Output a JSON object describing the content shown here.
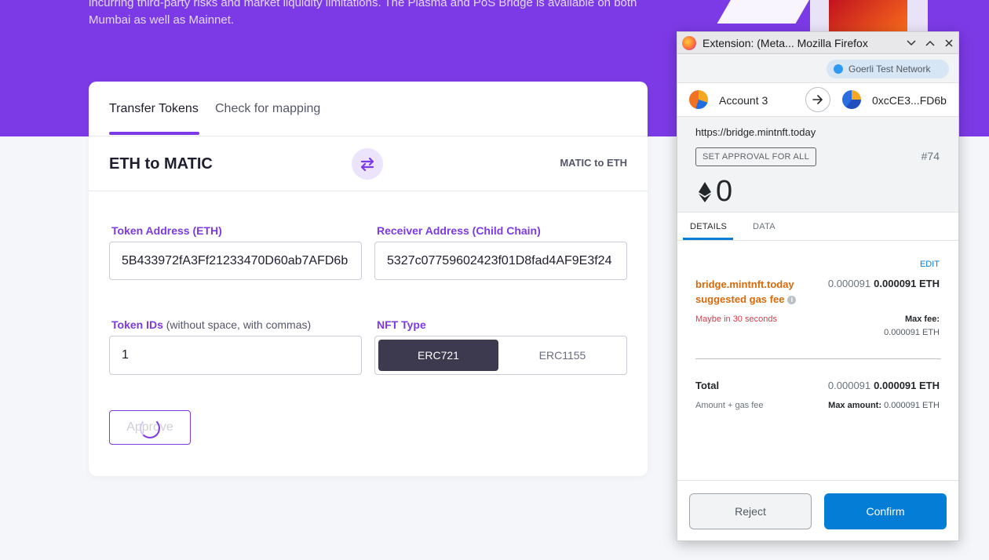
{
  "hero": {
    "text": "incurring third-party risks and market liquidity limitations. The Plasma and PoS Bridge is available on both Mumbai as well as Mainnet."
  },
  "bridge": {
    "tabs": [
      "Transfer Tokens",
      "Check for mapping"
    ],
    "direction_title": "ETH to MATIC",
    "direction_alt": "MATIC to ETH",
    "token_address_label": "Token Address (ETH)",
    "token_address_value": "5B433972fA3Ff21233470D60ab7AFD6b",
    "receiver_label": "Receiver Address (Child Chain)",
    "receiver_value": "5327c07759602423f01D8fad4AF9E3f24",
    "token_ids_label": "Token IDs",
    "token_ids_hint": "(without space, with commas)",
    "token_ids_value": "1",
    "nft_type_label": "NFT Type",
    "nft_types": [
      "ERC721",
      "ERC1155"
    ],
    "nft_selected": "ERC721",
    "approve_label": "Approve"
  },
  "popup": {
    "window_title": "Extension: (Meta... Mozilla Firefox",
    "network": "Goerli Test Network",
    "from_account": "Account 3",
    "to_account": "0xcCE3...FD6b",
    "origin": "https://bridge.mintnft.today",
    "action_tag": "SET APPROVAL FOR ALL",
    "nonce": "#74",
    "amount": "0",
    "tabs": [
      "DETAILS",
      "DATA"
    ],
    "edit": "EDIT",
    "gas_site": "bridge.mintnft.today",
    "gas_suggested": "suggested gas fee",
    "gas_dim": "0.000091",
    "gas_value": "0.000091 ETH",
    "timing": "Maybe in 30 seconds",
    "max_fee_label": "Max fee:",
    "max_fee_value": "0.000091 ETH",
    "total_label": "Total",
    "total_dim": "0.000091",
    "total_value": "0.000091 ETH",
    "amount_gas_label": "Amount + gas fee",
    "max_amount_label": "Max amount:",
    "max_amount_value": "0.000091 ETH",
    "reject": "Reject",
    "confirm": "Confirm"
  },
  "colors": {
    "brand_purple": "#7c3ae6",
    "metamask_blue": "#037dd6",
    "gas_orange": "#d66a0b",
    "warn_red": "#d73a49"
  }
}
